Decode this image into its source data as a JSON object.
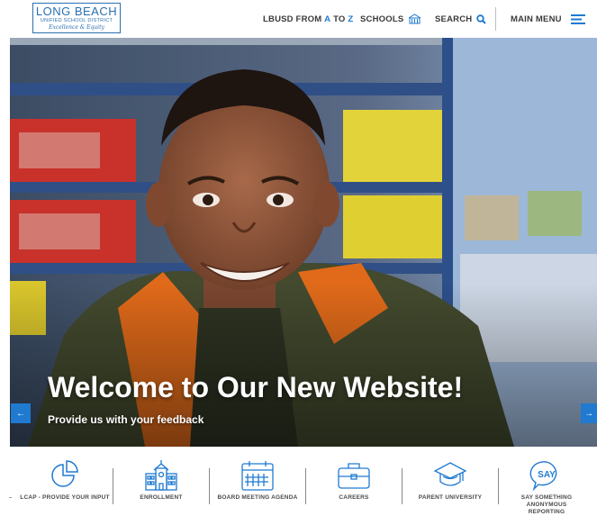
{
  "header": {
    "logo": {
      "line1": "LONG BEACH",
      "line2": "UNIFIED SCHOOL DISTRICT",
      "line3": "Excellence & Equity"
    },
    "nav": {
      "az_prefix": "LBUSD FROM ",
      "az_a": "A",
      "az_to": " TO ",
      "az_z": "Z",
      "schools": "SCHOOLS",
      "search": "SEARCH",
      "main_menu": "MAIN MENU"
    }
  },
  "hero": {
    "title": "Welcome to Our New Website!",
    "subtitle": "Provide us with your feedback",
    "prev": "←",
    "next": "→"
  },
  "quick_links": [
    {
      "label": "LCAP - PROVIDE YOUR INPUT",
      "icon": "pie-chart-icon"
    },
    {
      "label": "ENROLLMENT",
      "icon": "school-building-icon"
    },
    {
      "label": "BOARD MEETING AGENDA",
      "icon": "calendar-icon"
    },
    {
      "label": "CAREERS",
      "icon": "briefcase-icon"
    },
    {
      "label": "PARENT UNIVERSITY",
      "icon": "graduation-cap-icon"
    },
    {
      "label": "SAY SOMETHING ANONYMOUS REPORTING",
      "icon": "say-speech-bubble-icon",
      "icon_text": "SAY"
    }
  ],
  "colors": {
    "accent": "#1f7ad0",
    "logo": "#2a6fb0",
    "text": "#3a3a3a"
  }
}
